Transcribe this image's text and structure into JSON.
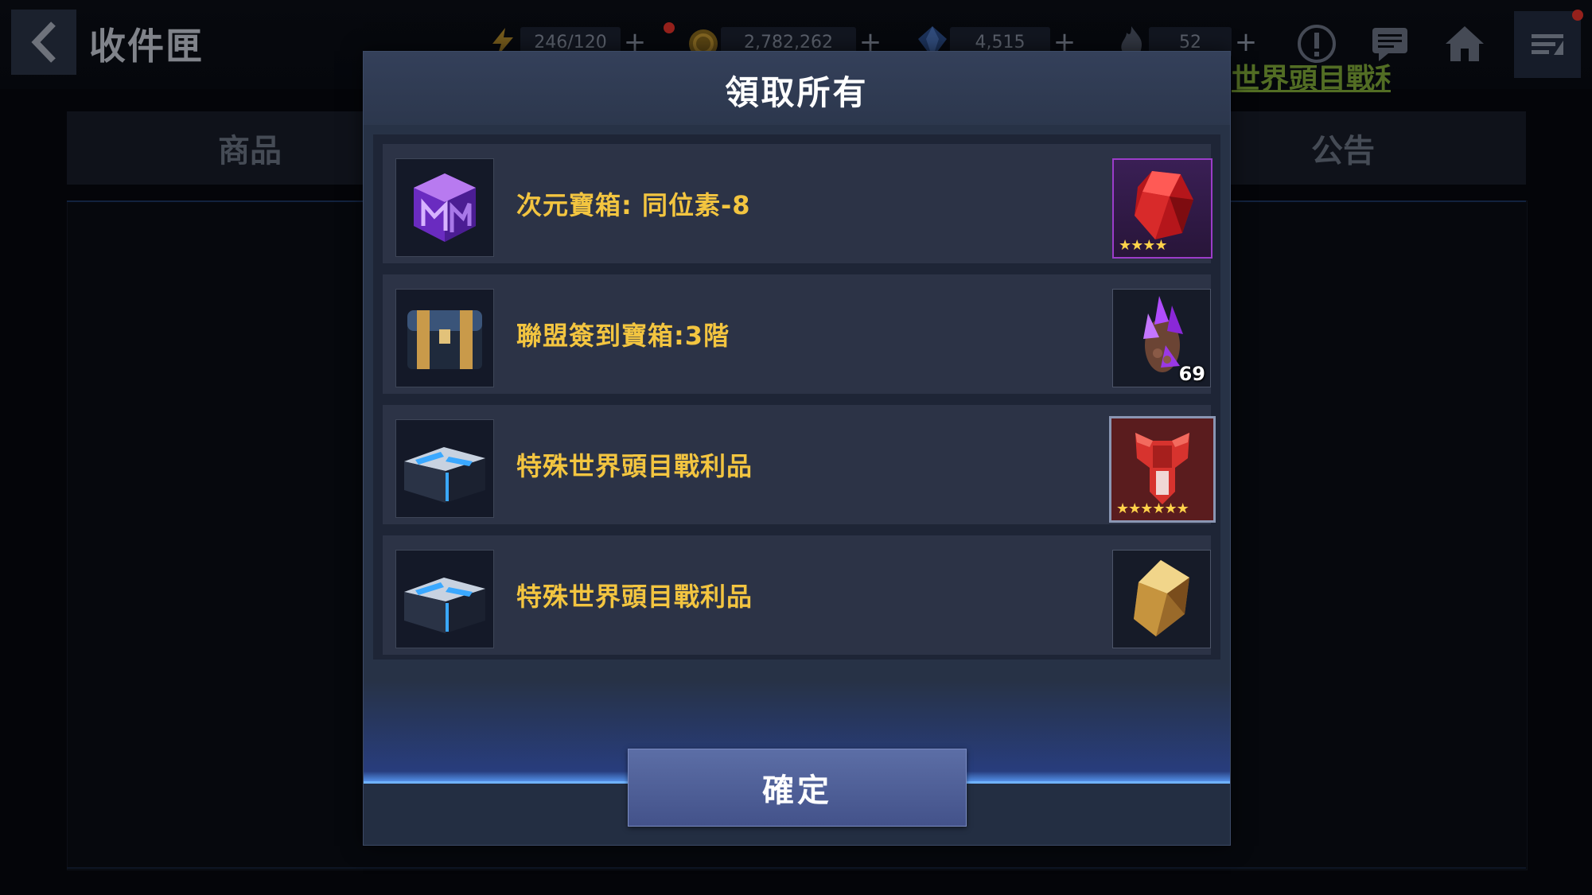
{
  "app": {
    "title": "收件匣",
    "icons": {
      "back": "back-arrow-icon",
      "alert": "alert-icon",
      "chat": "chat-icon",
      "home": "home-icon",
      "menu": "menu-icon"
    }
  },
  "resources": [
    {
      "id": "energy",
      "icon": "energy-icon",
      "value": "246/120",
      "has_notification": true
    },
    {
      "id": "gold",
      "icon": "gold-coin-icon",
      "value": "2,782,262"
    },
    {
      "id": "crystal",
      "icon": "crystal-icon",
      "value": "4,515"
    },
    {
      "id": "flame",
      "icon": "flame-icon",
      "value": "52"
    }
  ],
  "ticker": {
    "text": "世界頭目戰利"
  },
  "tabs": {
    "left": "商品",
    "right": "公告"
  },
  "modal": {
    "title": "領取所有",
    "items": [
      {
        "label": "次元寶箱: 同位素-8",
        "box_icon": "dimension-chest-icon",
        "reward_icon": "red-gem-icon",
        "reward_stars": "★★★★"
      },
      {
        "label": "聯盟簽到寶箱:3階",
        "box_icon": "alliance-chest-icon",
        "reward_icon": "purple-crystal-cluster-icon",
        "reward_qty": "69"
      },
      {
        "label": "特殊世界頭目戰利品",
        "box_icon": "boss-loot-chest-icon",
        "reward_icon": "red-armor-icon",
        "reward_stars": "★★★★★★"
      },
      {
        "label": "特殊世界頭目戰利品",
        "box_icon": "boss-loot-chest-icon",
        "reward_icon": "gold-stone-icon"
      }
    ],
    "confirm_label": "確定"
  },
  "colors": {
    "item_label": "#f3c540",
    "accent_glow": "#5da2ff",
    "confirm_button": "#4f5f98"
  }
}
